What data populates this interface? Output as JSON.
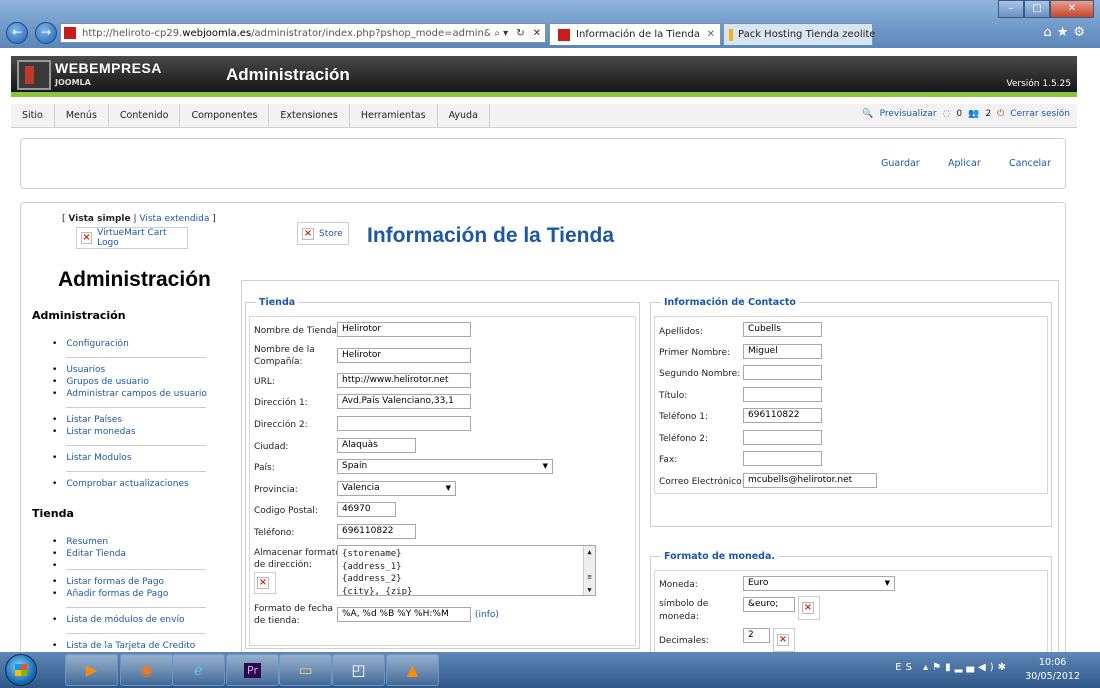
{
  "browser": {
    "address_url_gray": "http://heliroto-cp29.",
    "address_url_host": "webjoomla.es",
    "address_url_rest": "/administrator/index.php?pshop_mode=admin&page",
    "tabs": [
      {
        "label": "Información de la Tienda"
      },
      {
        "label": "Pack Hosting Tienda zeolite"
      }
    ]
  },
  "header": {
    "brand": "WEBEMPRESA",
    "sub": "JOOMLA",
    "title": "Administración",
    "version": "Versión 1.5.25"
  },
  "menu": [
    "Sitio",
    "Menús",
    "Contenido",
    "Componentes",
    "Extensiones",
    "Herramientas",
    "Ayuda"
  ],
  "status": {
    "preview": "Previsualizar",
    "messages": "0",
    "users": "2",
    "logout": "Cerrar sesión"
  },
  "toolbar": {
    "save": "Guardar",
    "apply": "Aplicar",
    "cancel": "Cancelar"
  },
  "sidebar": {
    "view_simple": "Vista simple",
    "view_sep": "|",
    "view_extended": "Vista extendida",
    "logo_alt": "VirtueMart Cart Logo",
    "title": "Administración",
    "section_admin": "Administración",
    "admin_items": [
      "Configuración",
      "Usuarios",
      "Grupos de usuario",
      "Administrar campos de usuario",
      "Listar Países",
      "Listar monedas",
      "Listar Modulos",
      "Comprobar actualizaciones"
    ],
    "section_store": "Tienda",
    "store_items": [
      "Resumen",
      "Editar Tienda",
      "",
      "Listar formas de Pago",
      "Añadir formas de Pago",
      "Lista de módulos de envío",
      "Lista de la Tarjeta de Credito"
    ]
  },
  "page": {
    "store_img_alt": "Store",
    "title": "Información de la Tienda"
  },
  "store": {
    "legend": "Tienda",
    "labels": {
      "name": "Nombre de Tienda:",
      "company_1": "Nombre de la",
      "company_2": "Compañía:",
      "url": "URL:",
      "addr1": "Dirección 1:",
      "addr2": "Dirección 2:",
      "city": "Ciudad:",
      "country": "País:",
      "state": "Provincia:",
      "zip": "Codigo Postal:",
      "phone": "Teléfono:",
      "addrfmt_1": "Almacenar formato",
      "addrfmt_2": "de dirección:",
      "datefmt_1": "Formato de fecha",
      "datefmt_2": "de tienda:"
    },
    "values": {
      "name": "Helirotor",
      "company": "Helirotor",
      "url": "http://www.helirotor.net",
      "addr1": "Avd.País Valenciano,33,1",
      "addr2": "",
      "city": "Alaquàs",
      "country": "Spain",
      "state": "Valencia",
      "zip": "46970",
      "phone": "696110822",
      "addrfmt_lines": [
        "{storename}",
        "{address_1}",
        "{address_2}",
        "{city}, {zip}"
      ],
      "datefmt": "%A, %d %B %Y %H:%M"
    },
    "info_link": "(info)"
  },
  "contact": {
    "legend": "Información de Contacto",
    "labels": {
      "last": "Apellidos:",
      "first": "Primer Nombre:",
      "middle": "Segundo Nombre:",
      "title": "Título:",
      "phone1": "Teléfono 1:",
      "phone2": "Teléfono 2:",
      "fax": "Fax:",
      "email": "Correo Electrónico:"
    },
    "values": {
      "last": "Cubells",
      "first": "Miguel",
      "middle": "",
      "title": "",
      "phone1": "696110822",
      "phone2": "",
      "fax": "",
      "email": "mcubells@helirotor.net"
    }
  },
  "currency": {
    "legend": "Formato de moneda.",
    "labels": {
      "currency": "Moneda:",
      "symbol_1": "símbolo de",
      "symbol_2": "moneda:",
      "decimals": "Decimales:"
    },
    "values": {
      "currency": "Euro",
      "symbol": "&euro;",
      "decimals": "2"
    }
  },
  "taskbar": {
    "lang": "ES",
    "time": "10:06",
    "date": "30/05/2012"
  }
}
